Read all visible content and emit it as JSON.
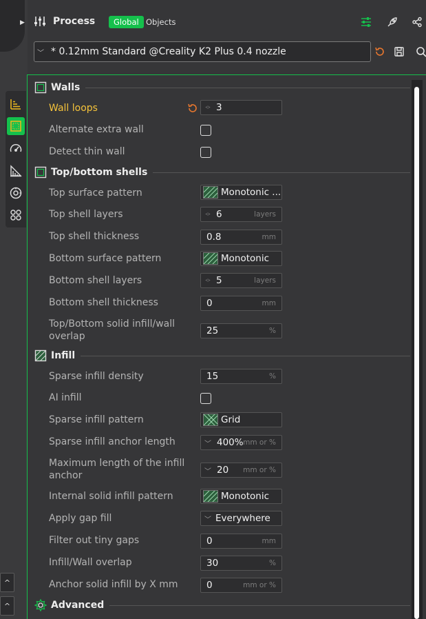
{
  "header": {
    "title": "Process",
    "tab_global": "Global",
    "tab_objects": "Objects",
    "icons": [
      "sliders-icon",
      "rocket-icon",
      "share-icon"
    ]
  },
  "preset": {
    "value": "* 0.12mm Standard @Creality K2 Plus 0.4 nozzle",
    "icons": [
      "reset-icon",
      "save-icon",
      "search-icon"
    ]
  },
  "sidebar": {
    "icons": [
      "quality-icon",
      "strength-icon",
      "speed-icon",
      "support-icon",
      "filament-icon",
      "others-icon"
    ],
    "bottom_buttons": [
      "^",
      "^"
    ]
  },
  "colors": {
    "accent": "#15c04c",
    "modified": "#f5c33b",
    "reset": "#e8772e"
  },
  "walls": {
    "title": "Walls",
    "wall_loops": {
      "label": "Wall loops",
      "value": "3"
    },
    "alternate_extra_wall": {
      "label": "Alternate extra wall",
      "checked": false
    },
    "detect_thin_wall": {
      "label": "Detect thin wall",
      "checked": false
    }
  },
  "shells": {
    "title": "Top/bottom shells",
    "top_surface_pattern": {
      "label": "Top surface pattern",
      "value": "Monotonic ..."
    },
    "top_shell_layers": {
      "label": "Top shell layers",
      "value": "6",
      "unit": "layers"
    },
    "top_shell_thickness": {
      "label": "Top shell thickness",
      "value": "0.8",
      "unit": "mm"
    },
    "bottom_surface_pattern": {
      "label": "Bottom surface pattern",
      "value": "Monotonic"
    },
    "bottom_shell_layers": {
      "label": "Bottom shell layers",
      "value": "5",
      "unit": "layers"
    },
    "bottom_shell_thickness": {
      "label": "Bottom shell thickness",
      "value": "0",
      "unit": "mm"
    },
    "solid_infill_overlap": {
      "label_line1": "Top/Bottom solid infill/wall",
      "label_line2": "overlap",
      "value": "25",
      "unit": "%"
    }
  },
  "infill": {
    "title": "Infill",
    "sparse_density": {
      "label": "Sparse infill density",
      "value": "15",
      "unit": "%"
    },
    "ai_infill": {
      "label": "AI infill",
      "checked": false
    },
    "sparse_pattern": {
      "label": "Sparse infill pattern",
      "value": "Grid"
    },
    "anchor_length": {
      "label": "Sparse infill anchor length",
      "value": "400%",
      "unit": "mm or %"
    },
    "max_anchor": {
      "label_line1": "Maximum length of the infill",
      "label_line2": "anchor",
      "value": "20",
      "unit": "mm or %"
    },
    "internal_solid_pattern": {
      "label": "Internal solid infill pattern",
      "value": "Monotonic"
    },
    "gap_fill": {
      "label": "Apply gap fill",
      "value": "Everywhere"
    },
    "filter_gaps": {
      "label": "Filter out tiny gaps",
      "value": "0",
      "unit": "mm"
    },
    "wall_overlap": {
      "label": "Infill/Wall overlap",
      "value": "30",
      "unit": "%"
    },
    "anchor_solid": {
      "label": "Anchor solid infill by X mm",
      "value": "0",
      "unit": "mm or %"
    }
  },
  "advanced": {
    "title": "Advanced"
  }
}
